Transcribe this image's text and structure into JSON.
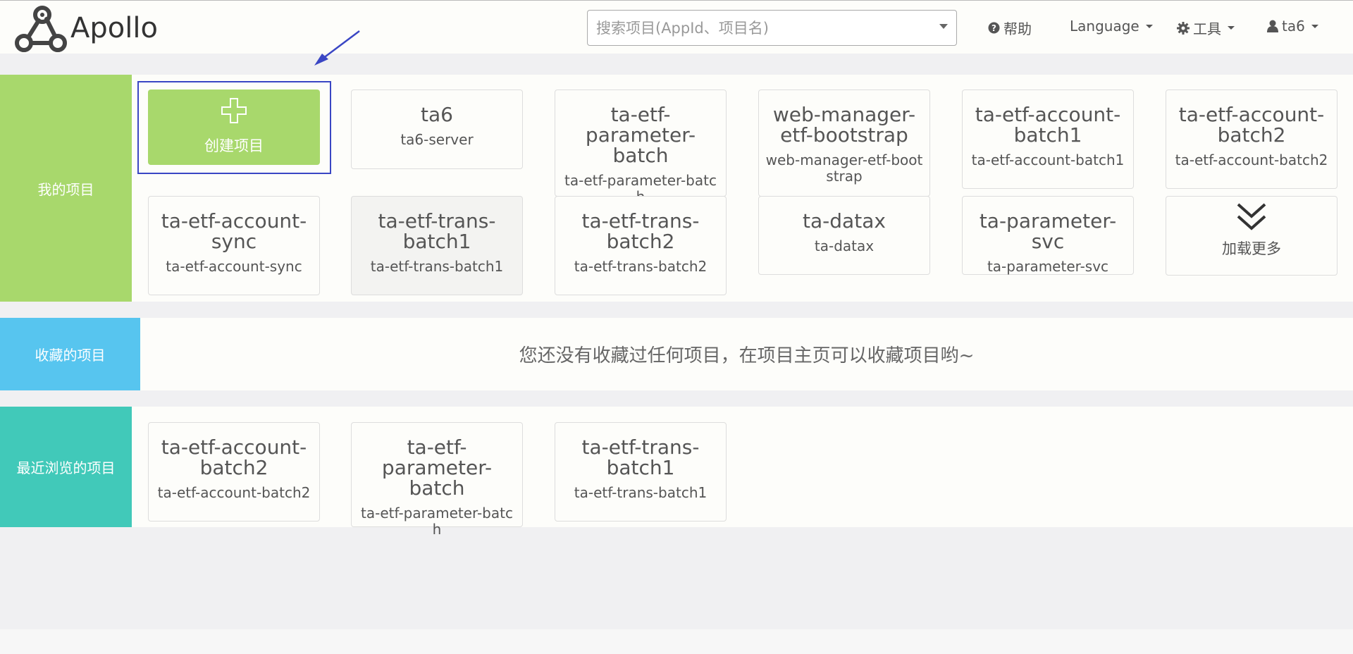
{
  "app": {
    "name": "Apollo"
  },
  "header": {
    "search_placeholder": "搜索项目(AppId、项目名)",
    "help_label": "帮助",
    "language_label": "Language",
    "tools_label": "工具",
    "user_label": "ta6"
  },
  "my_projects": {
    "label": "我的项目",
    "create_label": "创建项目",
    "load_more_label": "加载更多",
    "items": [
      {
        "title": "ta6",
        "sub": "ta6-server"
      },
      {
        "title": "ta-etf-parameter-batch",
        "sub": "ta-etf-parameter-batch"
      },
      {
        "title": "web-manager-etf-bootstrap",
        "sub": "web-manager-etf-bootstrap"
      },
      {
        "title": "ta-etf-account-batch1",
        "sub": "ta-etf-account-batch1"
      },
      {
        "title": "ta-etf-account-batch2",
        "sub": "ta-etf-account-batch2"
      },
      {
        "title": "ta-etf-account-sync",
        "sub": "ta-etf-account-sync"
      },
      {
        "title": "ta-etf-trans-batch1",
        "sub": "ta-etf-trans-batch1"
      },
      {
        "title": "ta-etf-trans-batch2",
        "sub": "ta-etf-trans-batch2"
      },
      {
        "title": "ta-datax",
        "sub": "ta-datax"
      },
      {
        "title": "ta-parameter-svc",
        "sub": "ta-parameter-svc"
      }
    ]
  },
  "favorites": {
    "label": "收藏的项目",
    "empty_message": "您还没有收藏过任何项目，在项目主页可以收藏项目哟~"
  },
  "recent": {
    "label": "最近浏览的项目",
    "items": [
      {
        "title": "ta-etf-account-batch2",
        "sub": "ta-etf-account-batch2"
      },
      {
        "title": "ta-etf-parameter-batch",
        "sub": "ta-etf-parameter-batch"
      },
      {
        "title": "ta-etf-trans-batch1",
        "sub": "ta-etf-trans-batch1"
      }
    ]
  },
  "colors": {
    "my_projects": "#a8d86c",
    "favorites": "#57c5ef",
    "recent": "#41c9b9",
    "annotation": "#3a46c4"
  }
}
